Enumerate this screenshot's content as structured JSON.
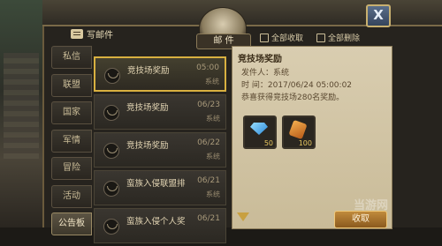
{
  "header": {
    "compose_label": "写邮件",
    "emblem_label": "邮 件",
    "collect_all_label": "全部收取",
    "delete_all_label": "全部删除",
    "close_label": "X"
  },
  "tabs": [
    {
      "label": "私信",
      "active": false
    },
    {
      "label": "联盟",
      "active": false
    },
    {
      "label": "国家",
      "active": false
    },
    {
      "label": "军情",
      "active": false
    },
    {
      "label": "冒险",
      "active": false
    },
    {
      "label": "活动",
      "active": false
    },
    {
      "label": "公告板",
      "active": true
    }
  ],
  "mails": [
    {
      "title": "竞技场奖励",
      "date": "05:00",
      "sender": "系统",
      "selected": true
    },
    {
      "title": "竞技场奖励",
      "date": "06/23",
      "sender": "系统",
      "selected": false
    },
    {
      "title": "竞技场奖励",
      "date": "06/22",
      "sender": "系统",
      "selected": false
    },
    {
      "title": "蛮族入侵联盟排",
      "date": "06/21",
      "sender": "系统",
      "selected": false
    },
    {
      "title": "蛮族入侵个人奖",
      "date": "06/21",
      "sender": "",
      "selected": false
    }
  ],
  "detail": {
    "title": "竞技场奖励",
    "sender_line": "发件人：系统",
    "time_line": "时  间：2017/06/24  05:00:02",
    "body": "恭喜获得竞技场280名奖励。",
    "rewards": [
      {
        "icon": "diamond-icon",
        "qty": "50"
      },
      {
        "icon": "scroll-icon",
        "qty": "100"
      }
    ],
    "collect_label": "收取"
  },
  "watermark": "当游网"
}
